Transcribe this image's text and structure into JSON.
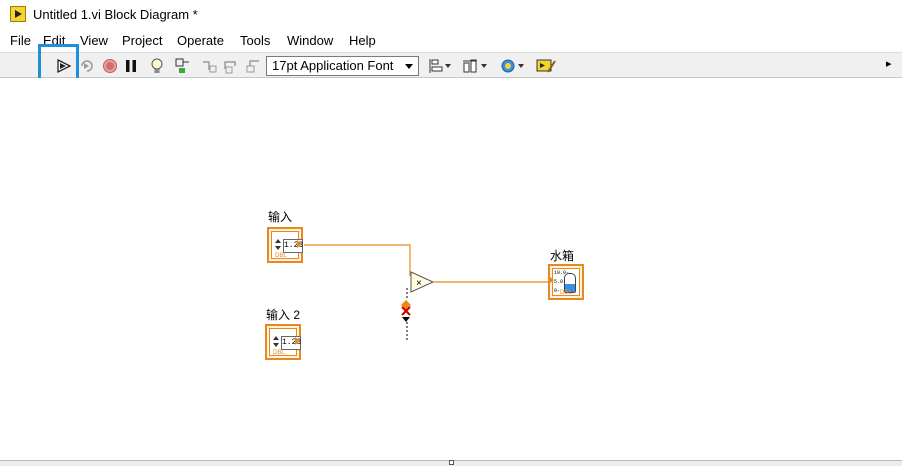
{
  "window": {
    "title": "Untitled 1.vi Block Diagram *"
  },
  "menu": [
    "File",
    "Edit",
    "View",
    "Project",
    "Operate",
    "Tools",
    "Window",
    "Help"
  ],
  "toolbar": {
    "buttons": [
      "run-icon",
      "run-continuously-icon",
      "abort-icon",
      "pause-icon",
      "highlight-execution-icon",
      "retain-wire-values-icon",
      "step-into-icon",
      "step-over-icon",
      "step-out-icon",
      "align-objects-icon",
      "distribute-objects-icon",
      "reorder-icon",
      "cleanup-diagram-icon"
    ],
    "font_select_value": "17pt Application Font",
    "overflow_glyph": "▸"
  },
  "diagram": {
    "control1_label": "输入",
    "control2_label": "输入 2",
    "indicator_label": "水箱",
    "numeric_text": "1.23",
    "dbl_text": "DBL",
    "multiply_glyph": "×",
    "tank_scale": [
      "10.0-",
      "5.0-",
      "0-"
    ]
  },
  "colors": {
    "highlight_box": "#1e90d8",
    "wire": "#e8891f",
    "tank_fill": "#3a8ee6",
    "toolbar_bg": "#f0f0f0"
  }
}
